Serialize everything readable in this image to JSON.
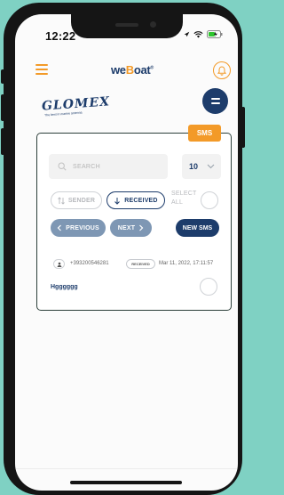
{
  "status_bar": {
    "time": "12:22"
  },
  "header": {
    "brand_prefix": "we",
    "brand_b": "B",
    "brand_suffix": "oat",
    "brand_mark": "®"
  },
  "logo": {
    "text": "GLOMEX",
    "tagline": "The best in marine antenna"
  },
  "sms_card": {
    "tab_label": "SMS",
    "search": {
      "placeholder": "SEARCH"
    },
    "page_size": {
      "value": "10"
    },
    "filters": {
      "sender": "SENDER",
      "received": "RECEIVED",
      "select_all_line1": "SELECT",
      "select_all_line2": "ALL"
    },
    "buttons": {
      "previous": "PREVIOUS",
      "next": "NEXT",
      "new_sms": "NEW SMS"
    },
    "messages": [
      {
        "phone": "+393200546281",
        "status": "RECEIVED",
        "date": "Mar 11, 2022, 17:11:57",
        "text": "Hgggggg"
      }
    ]
  },
  "colors": {
    "accent": "#f39a28",
    "navy": "#1d3c6b",
    "nav_pill": "#7e97b4",
    "background": "#7fd1c3"
  },
  "icons": [
    "menu-icon",
    "bell-icon",
    "search-icon",
    "chevron-down-icon",
    "sort-icon",
    "arrow-down-icon",
    "chevron-left-icon",
    "chevron-right-icon",
    "person-icon",
    "wifi-icon",
    "battery-icon",
    "location-icon"
  ]
}
